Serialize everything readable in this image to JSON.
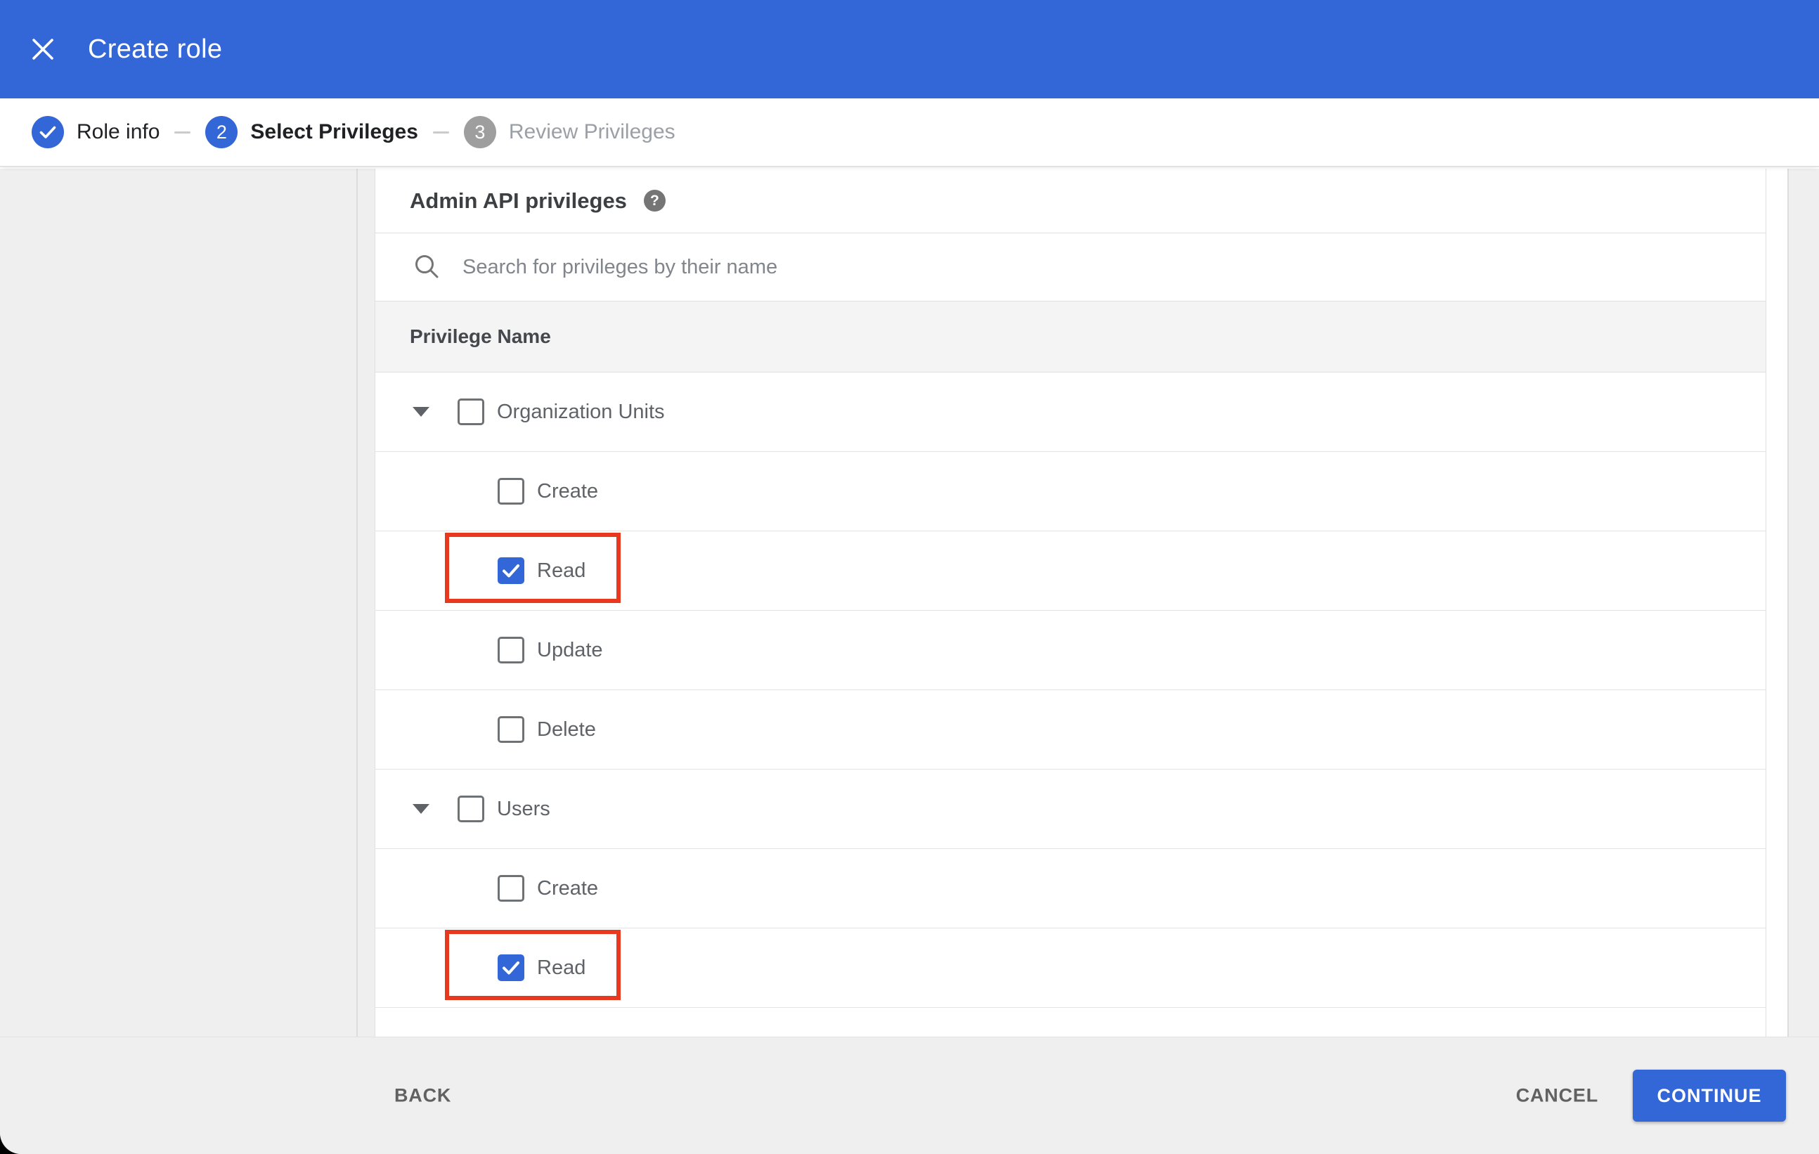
{
  "appbar": {
    "title": "Create role",
    "close_icon": "x"
  },
  "stepper": {
    "steps": [
      {
        "number": "1",
        "label": "Role info",
        "state": "completed",
        "icon": "check"
      },
      {
        "number": "2",
        "label": "Select Privileges",
        "state": "active"
      },
      {
        "number": "3",
        "label": "Review Privileges",
        "state": "upcoming"
      }
    ]
  },
  "panel": {
    "title": "Admin API privileges",
    "help_icon": "?",
    "search": {
      "placeholder": "Search for privileges by their name",
      "value": ""
    },
    "table": {
      "header": "Privilege Name",
      "groups": [
        {
          "label": "Organization Units",
          "checked": false,
          "expanded": true,
          "children": [
            {
              "label": "Create",
              "checked": false,
              "highlighted": false
            },
            {
              "label": "Read",
              "checked": true,
              "highlighted": true
            },
            {
              "label": "Update",
              "checked": false,
              "highlighted": false
            },
            {
              "label": "Delete",
              "checked": false,
              "highlighted": false
            }
          ]
        },
        {
          "label": "Users",
          "checked": false,
          "expanded": true,
          "children": [
            {
              "label": "Create",
              "checked": false,
              "highlighted": false
            },
            {
              "label": "Read",
              "checked": true,
              "highlighted": true
            }
          ]
        }
      ]
    }
  },
  "footer": {
    "back_label": "BACK",
    "cancel_label": "CANCEL",
    "continue_label": "CONTINUE"
  },
  "colors": {
    "accent_blue": "#3366d6",
    "annotation_red": "#e8391f",
    "workspace_gray": "#efefef",
    "thead_gray": "#f4f4f4",
    "step_inactive_gray": "#9e9e9e"
  }
}
